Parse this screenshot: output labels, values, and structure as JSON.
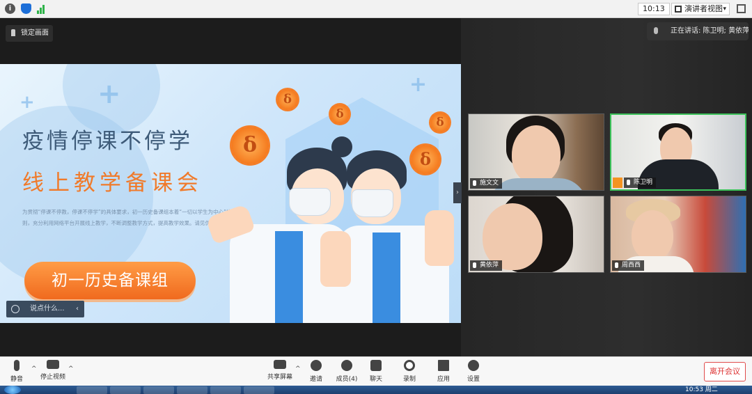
{
  "topbar": {
    "time": "10:13",
    "view_label": "演讲者视图",
    "view_caret": "▾"
  },
  "lock_screen_label": "锁定画面",
  "speaking_label": "正在讲话: 陈卫明; 黄依萍;",
  "slide": {
    "title_line1": "疫情停课不停学",
    "title_line2": "线上教学备课会",
    "paragraph": "为贯彻“停课不停教，停课不停学”的具体要求，初一历史备课组本着“一切以学生为中心”的原则，充分利用网络平台开展线上教学，不断调整教学方式，提高教学效果。请见优质教学资源。",
    "pill_label": "初一历史备课组",
    "virus_glyph": "δ"
  },
  "chat_bar": {
    "placeholder": "说点什么...",
    "arrow": "‹"
  },
  "collapse_arrow": "›",
  "participants": [
    {
      "name": "施文文",
      "active": false
    },
    {
      "name": "陈卫明",
      "active": true
    },
    {
      "name": "黄依萍",
      "active": false
    },
    {
      "name": "周西西",
      "active": false
    }
  ],
  "toolbar": {
    "mute_label": "静音",
    "stop_video_label": "停止视频",
    "share_label": "共享屏幕",
    "invite_label": "邀请",
    "members_label": "成员(4)",
    "chat_label": "聊天",
    "record_label": "录制",
    "apps_label": "应用",
    "settings_label": "设置",
    "leave_label": "离开会议",
    "caret": "^"
  },
  "taskbar": {
    "clock": "10:53 周二"
  },
  "colors": {
    "accent_orange": "#f07a2a",
    "active_border": "#3cc25a",
    "leave_red": "#d33333"
  }
}
